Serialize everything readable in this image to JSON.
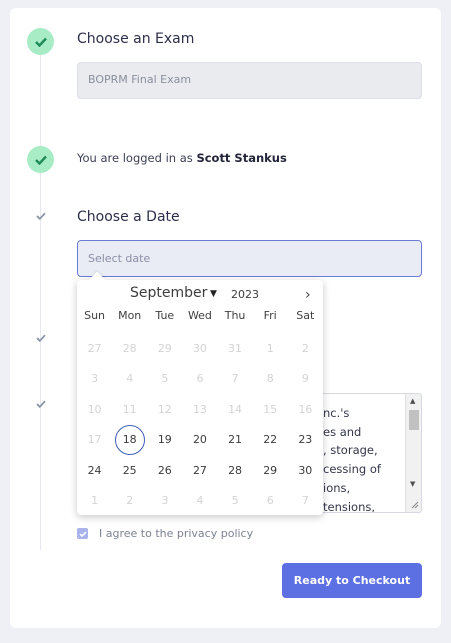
{
  "steps": {
    "exam": {
      "title": "Choose an Exam",
      "selected_value": "BOPRM Final Exam"
    },
    "login": {
      "prefix": "You are logged in as",
      "user": "Scott Stankus"
    },
    "date": {
      "title": "Choose a Date",
      "placeholder": "Select date"
    }
  },
  "datepicker": {
    "month": "September",
    "year": "2023",
    "next_symbol": "›",
    "weekdays": [
      "Sun",
      "Mon",
      "Tue",
      "Wed",
      "Thu",
      "Fri",
      "Sat"
    ],
    "weeks": [
      [
        {
          "d": "27",
          "m": "prev"
        },
        {
          "d": "28",
          "m": "prev"
        },
        {
          "d": "29",
          "m": "prev"
        },
        {
          "d": "30",
          "m": "prev"
        },
        {
          "d": "31",
          "m": "prev"
        },
        {
          "d": "1",
          "m": "dis"
        },
        {
          "d": "2",
          "m": "dis"
        }
      ],
      [
        {
          "d": "3",
          "m": "dis"
        },
        {
          "d": "4",
          "m": "dis"
        },
        {
          "d": "5",
          "m": "dis"
        },
        {
          "d": "6",
          "m": "dis"
        },
        {
          "d": "7",
          "m": "dis"
        },
        {
          "d": "8",
          "m": "dis"
        },
        {
          "d": "9",
          "m": "dis"
        }
      ],
      [
        {
          "d": "10",
          "m": "dis"
        },
        {
          "d": "11",
          "m": "dis"
        },
        {
          "d": "12",
          "m": "dis"
        },
        {
          "d": "13",
          "m": "dis"
        },
        {
          "d": "14",
          "m": "dis"
        },
        {
          "d": "15",
          "m": "dis"
        },
        {
          "d": "16",
          "m": "dis"
        }
      ],
      [
        {
          "d": "17",
          "m": "dis"
        },
        {
          "d": "18",
          "m": "sel"
        },
        {
          "d": "19",
          "m": "cur"
        },
        {
          "d": "20",
          "m": "cur"
        },
        {
          "d": "21",
          "m": "cur"
        },
        {
          "d": "22",
          "m": "cur"
        },
        {
          "d": "23",
          "m": "cur"
        }
      ],
      [
        {
          "d": "24",
          "m": "cur"
        },
        {
          "d": "25",
          "m": "cur"
        },
        {
          "d": "26",
          "m": "cur"
        },
        {
          "d": "27",
          "m": "cur"
        },
        {
          "d": "28",
          "m": "cur"
        },
        {
          "d": "29",
          "m": "cur"
        },
        {
          "d": "30",
          "m": "cur"
        }
      ],
      [
        {
          "d": "1",
          "m": "next"
        },
        {
          "d": "2",
          "m": "next"
        },
        {
          "d": "3",
          "m": "next"
        },
        {
          "d": "4",
          "m": "next"
        },
        {
          "d": "5",
          "m": "next"
        },
        {
          "d": "6",
          "m": "next"
        },
        {
          "d": "7",
          "m": "next"
        }
      ]
    ]
  },
  "policy": {
    "visible_lines": [
      "nc.'s",
      "es and",
      ", storage,",
      "cessing of",
      "ions,",
      "tensions,"
    ]
  },
  "agree": {
    "label": "I agree to the privacy policy",
    "checked": true
  },
  "checkout_label": "Ready to Checkout",
  "colors": {
    "accent": "#5c6fe3",
    "success_bg": "#a8ecc6",
    "success_check": "#1f8a57"
  }
}
